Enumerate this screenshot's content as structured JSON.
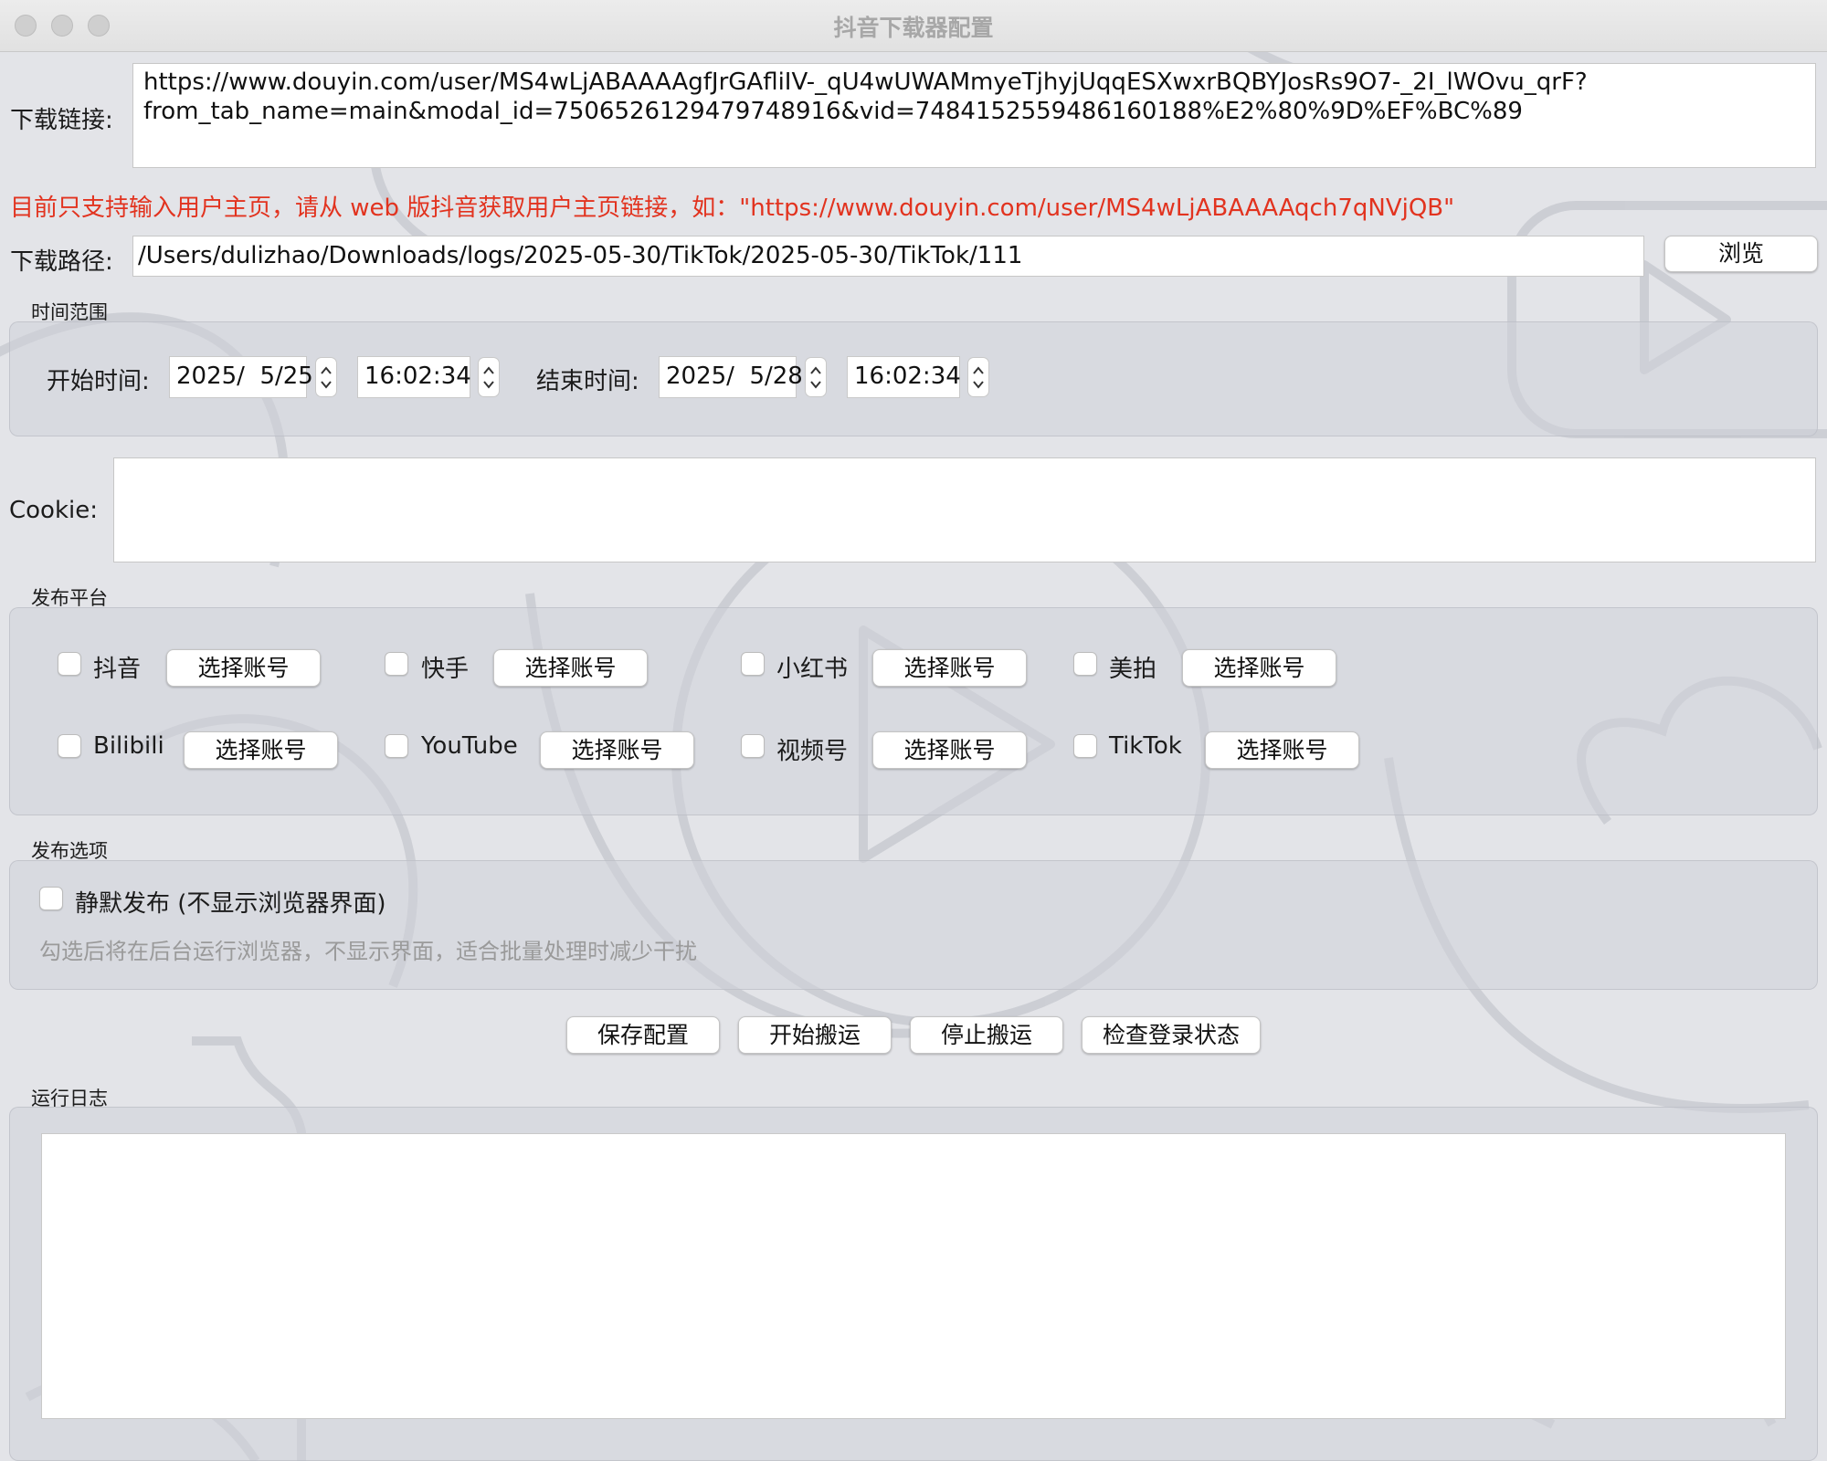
{
  "window": {
    "title": "抖音下载器配置"
  },
  "download": {
    "link_label": "下载链接:",
    "link_value": "https://www.douyin.com/user/MS4wLjABAAAAgfJrGAfliIV-_qU4wUWAMmyeTjhyjUqqESXwxrBQBYJosRs9O7-_2I_lWOvu_qrF?\nfrom_tab_name=main&modal_id=7506526129479748916&vid=7484152559486160188%E2%80%9D%EF%BC%89",
    "notice": "目前只支持输入用户主页，请从 web 版抖音获取用户主页链接，如：\"https://www.douyin.com/user/MS4wLjABAAAAqch7qNVjQB\"",
    "path_label": "下载路径:",
    "path_value": "/Users/dulizhao/Downloads/logs/2025-05-30/TikTok/2025-05-30/TikTok/111",
    "browse_label": "浏览"
  },
  "time_range": {
    "title": "时间范围",
    "start_label": "开始时间:",
    "start_date": "2025/  5/25",
    "start_time": "16:02:34",
    "end_label": "结束时间:",
    "end_date": "2025/  5/28",
    "end_time": "16:02:34"
  },
  "cookie": {
    "label": "Cookie:",
    "value": ""
  },
  "platforms": {
    "title": "发布平台",
    "select_label": "选择账号",
    "items": [
      {
        "name": "抖音",
        "checked": false
      },
      {
        "name": "快手",
        "checked": false
      },
      {
        "name": "小红书",
        "checked": false
      },
      {
        "name": "美拍",
        "checked": false
      },
      {
        "name": "Bilibili",
        "checked": false
      },
      {
        "name": "YouTube",
        "checked": false
      },
      {
        "name": "视频号",
        "checked": false
      },
      {
        "name": "TikTok",
        "checked": false
      }
    ]
  },
  "options": {
    "title": "发布选项",
    "silent_label": "静默发布 (不显示浏览器界面)",
    "silent_checked": false,
    "hint": "勾选后将在后台运行浏览器，不显示界面，适合批量处理时减少干扰"
  },
  "actions": {
    "save": "保存配置",
    "start": "开始搬运",
    "stop": "停止搬运",
    "check_login": "检查登录状态"
  },
  "log": {
    "title": "运行日志",
    "content": ""
  }
}
